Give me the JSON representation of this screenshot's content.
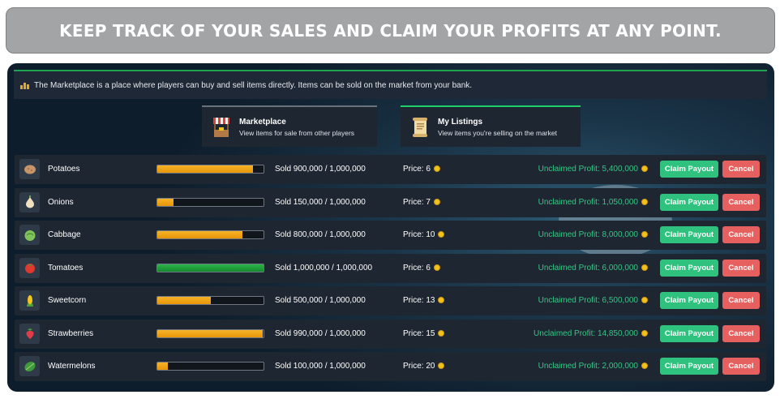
{
  "banner": {
    "text": "KEEP TRACK OF YOUR SALES AND CLAIM YOUR PROFITS AT ANY POINT."
  },
  "notice": {
    "icon": "chart-bars-icon",
    "text": "The Marketplace is a place where players can buy and sell items directly. Items can be sold on the market from your bank."
  },
  "tabs": [
    {
      "title": "Marketplace",
      "desc": "View items for sale from other players",
      "icon": "market-stall-icon",
      "active": false
    },
    {
      "title": "My Listings",
      "desc": "View items you're selling on the market",
      "icon": "scroll-icon",
      "active": true
    }
  ],
  "listings": [
    {
      "name": "Potatoes",
      "icon": "potato-icon",
      "color": "#c8956a",
      "sold": "Sold 900,000 / 1,000,000",
      "progress": 0.9,
      "price": "Price: 6",
      "profit": "Unclaimed Profit: 5,400,000"
    },
    {
      "name": "Onions",
      "icon": "onion-icon",
      "color": "#f0e2c0",
      "sold": "Sold 150,000 / 1,000,000",
      "progress": 0.15,
      "price": "Price: 7",
      "profit": "Unclaimed Profit: 1,050,000"
    },
    {
      "name": "Cabbage",
      "icon": "cabbage-icon",
      "color": "#7fc45a",
      "sold": "Sold 800,000 / 1,000,000",
      "progress": 0.8,
      "price": "Price: 10",
      "profit": "Unclaimed Profit: 8,000,000"
    },
    {
      "name": "Tomatoes",
      "icon": "tomato-icon",
      "color": "#e0382f",
      "sold": "Sold 1,000,000 / 1,000,000",
      "progress": 1.0,
      "price": "Price: 6",
      "profit": "Unclaimed Profit: 6,000,000"
    },
    {
      "name": "Sweetcorn",
      "icon": "corn-icon",
      "color": "#f2c51f",
      "sold": "Sold 500,000 / 1,000,000",
      "progress": 0.5,
      "price": "Price: 13",
      "profit": "Unclaimed Profit: 6,500,000"
    },
    {
      "name": "Strawberries",
      "icon": "strawberry-icon",
      "color": "#e23b4a",
      "sold": "Sold 990,000 / 1,000,000",
      "progress": 0.99,
      "price": "Price: 15",
      "profit": "Unclaimed Profit: 14,850,000"
    },
    {
      "name": "Watermelons",
      "icon": "watermelon-icon",
      "color": "#3f9a3c",
      "sold": "Sold 100,000 / 1,000,000",
      "progress": 0.1,
      "price": "Price: 20",
      "profit": "Unclaimed Profit: 2,000,000"
    }
  ],
  "buttons": {
    "claim": "Claim Payout",
    "cancel": "Cancel"
  },
  "colors": {
    "claim": "#2ec27e",
    "cancel": "#e5605e",
    "profit": "#34c784",
    "progress_partial": "#f2a516",
    "progress_full": "#1fa34f"
  }
}
